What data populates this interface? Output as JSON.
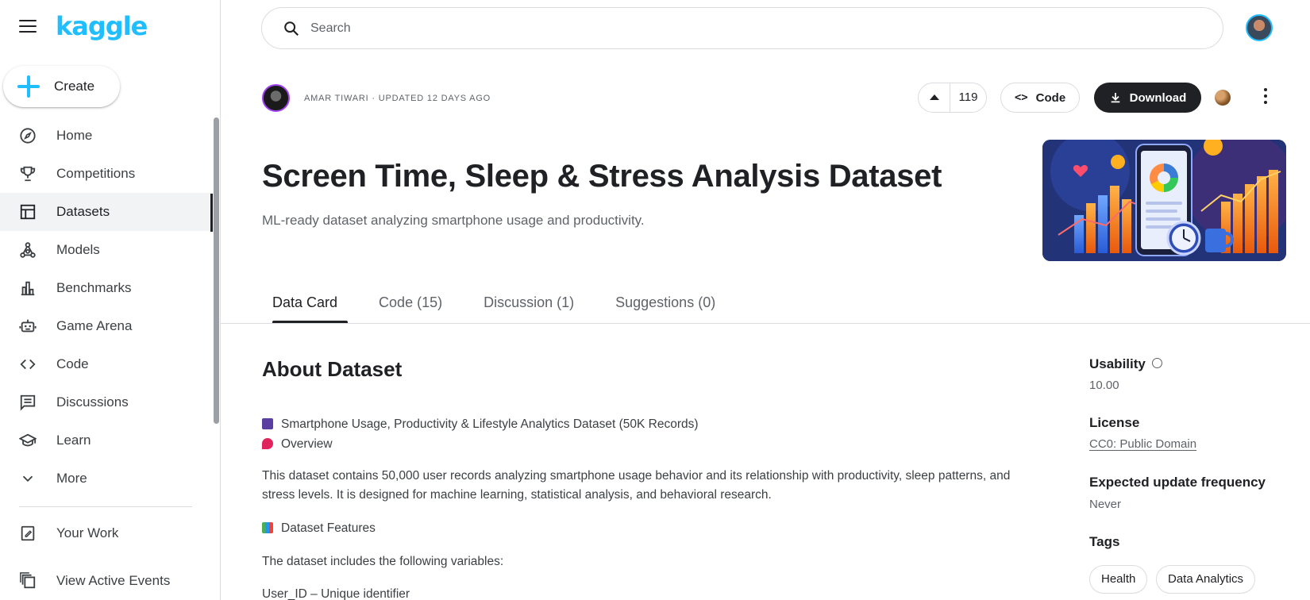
{
  "app": {
    "logo_text": "kaggle",
    "create_label": "Create"
  },
  "sidebar": {
    "items": [
      {
        "label": "Home",
        "icon": "compass-icon"
      },
      {
        "label": "Competitions",
        "icon": "trophy-icon"
      },
      {
        "label": "Datasets",
        "icon": "table-icon",
        "active": true
      },
      {
        "label": "Models",
        "icon": "models-icon"
      },
      {
        "label": "Benchmarks",
        "icon": "bar-chart-icon"
      },
      {
        "label": "Game Arena",
        "icon": "robot-icon"
      },
      {
        "label": "Code",
        "icon": "code-icon"
      },
      {
        "label": "Discussions",
        "icon": "comment-icon"
      },
      {
        "label": "Learn",
        "icon": "school-icon"
      },
      {
        "label": "More",
        "icon": "chevron-down-icon"
      }
    ],
    "secondary": [
      {
        "label": "Your Work",
        "icon": "edit-note-icon"
      },
      {
        "label": "View Active Events",
        "icon": "stacked-pages-icon"
      }
    ]
  },
  "search": {
    "placeholder": "Search"
  },
  "header": {
    "owner_line": "AMAR TIWARI · UPDATED 12 DAYS AGO",
    "upvotes": "119",
    "code_label": "Code",
    "download_label": "Download"
  },
  "dataset": {
    "title": "Screen Time, Sleep & Stress Analysis Dataset",
    "subtitle": "ML-ready dataset analyzing smartphone usage and productivity."
  },
  "tabs": [
    {
      "label": "Data Card",
      "active": true
    },
    {
      "label": "Code (15)"
    },
    {
      "label": "Discussion (1)"
    },
    {
      "label": "Suggestions (0)"
    }
  ],
  "about": {
    "title": "About Dataset",
    "line1": "Smartphone Usage, Productivity & Lifestyle Analytics Dataset (50K Records)",
    "line2": "Overview",
    "para1a": "This dataset contains 50,000 user records analyzing smartphone usage behavior and its relationship with productivity, sleep patterns, and",
    "para1b": "stress levels. It is designed for machine learning, statistical analysis, and behavioral research.",
    "features": "Dataset Features",
    "includes": "The dataset includes the following variables:",
    "var1": "User_ID – Unique identifier"
  },
  "side_panel": {
    "usability_label": "Usability",
    "usability_value": "10.00",
    "license_label": "License",
    "license_value": "CC0: Public Domain",
    "frequency_label": "Expected update frequency",
    "frequency_value": "Never",
    "tags_label": "Tags",
    "tags": [
      "Health",
      "Data Analytics"
    ]
  },
  "colors": {
    "brand": "#20beff",
    "text": "#202124",
    "muted": "#5f6368",
    "border": "#dadce0"
  }
}
